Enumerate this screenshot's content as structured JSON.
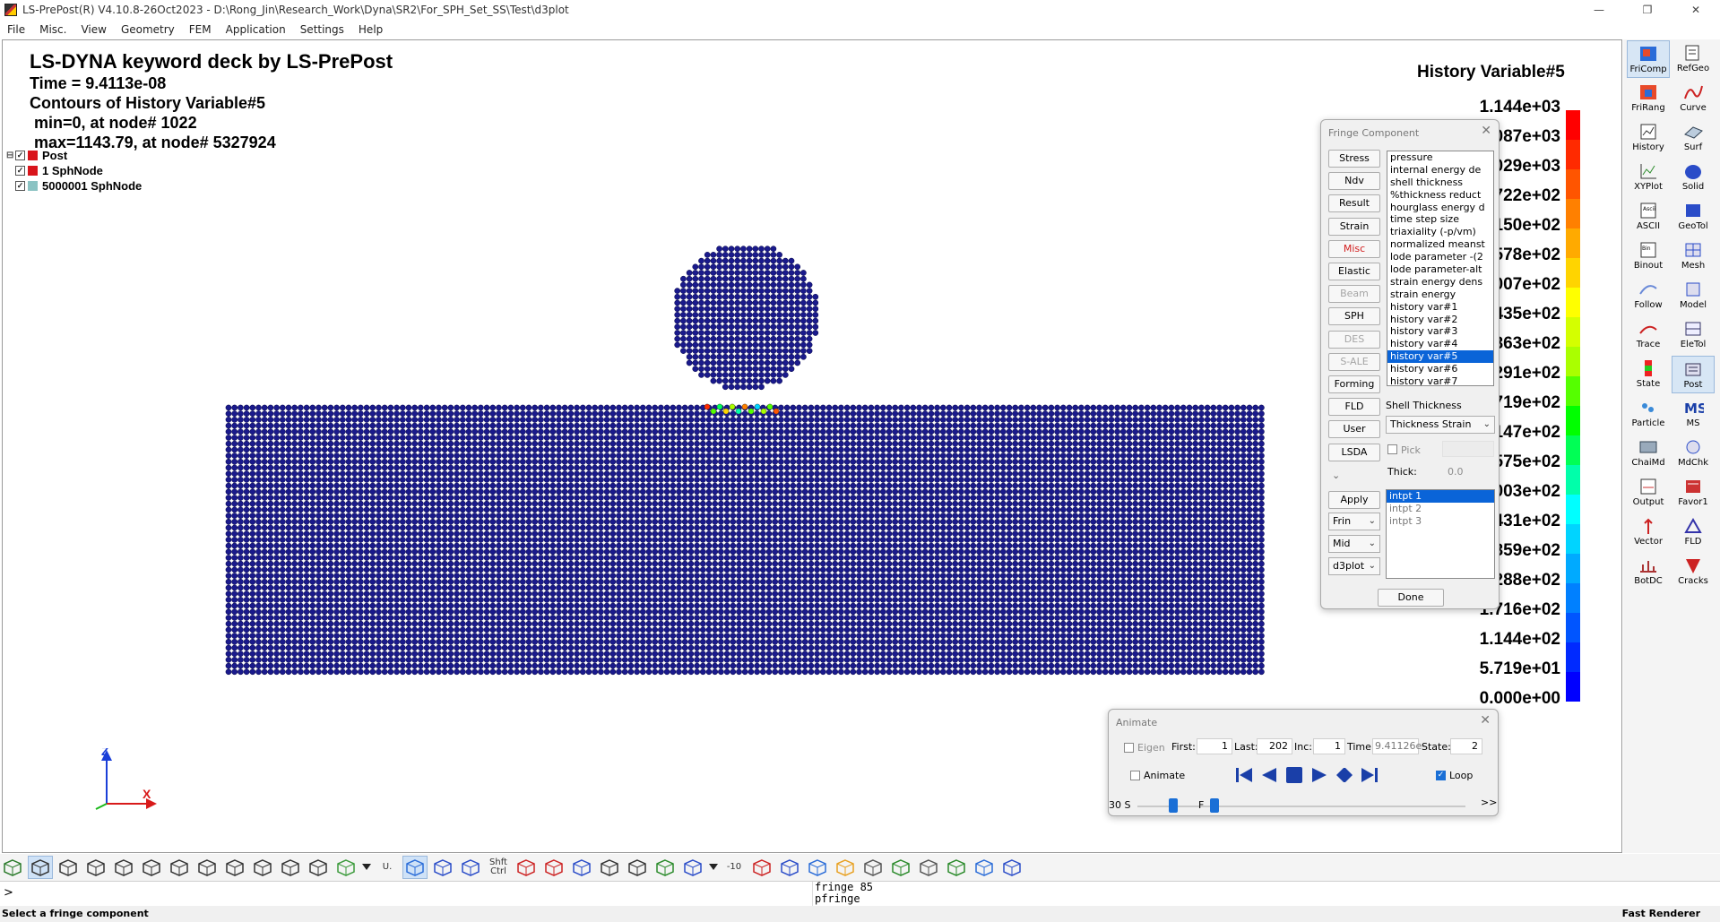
{
  "window": {
    "title": "LS-PrePost(R) V4.10.8-26Oct2023 - D:\\Rong_Jin\\Research_Work\\Dyna\\SR2\\For_SPH_Set_SS\\Test\\d3plot",
    "controls": [
      "—",
      "❐",
      "✕"
    ]
  },
  "menu": [
    "File",
    "Misc.",
    "View",
    "Geometry",
    "FEM",
    "Application",
    "Settings",
    "Help"
  ],
  "viewport": {
    "info_lines": [
      "LS-DYNA keyword deck by LS-PrePost",
      "Time =  9.4113e-08",
      "Contours of History Variable#5",
      " min=0, at node# 1022",
      " max=1143.79, at node# 5327924"
    ],
    "tree": {
      "root": "Post",
      "items": [
        {
          "label": "1 SphNode",
          "color": "#d9141b"
        },
        {
          "label": "5000001 SphNode",
          "color": "#8bc3c3"
        }
      ],
      "root_color": "#d9141b"
    },
    "particle_color": "#1a1a8c",
    "legend": {
      "title": "History Variable#5",
      "labels": [
        "1.144e+03",
        "1.087e+03",
        "1.029e+03",
        "9.722e+02",
        "9.150e+02",
        "8.578e+02",
        "8.007e+02",
        "7.435e+02",
        "6.863e+02",
        "6.291e+02",
        "5.719e+02",
        "5.147e+02",
        "4.575e+02",
        "4.003e+02",
        "3.431e+02",
        "2.859e+02",
        "2.288e+02",
        "1.716e+02",
        "1.144e+02",
        "5.719e+01",
        "0.000e+00"
      ],
      "colors": [
        "#ff0000",
        "#ff2a00",
        "#ff5500",
        "#ff8000",
        "#ffaa00",
        "#ffd400",
        "#ffff00",
        "#d4ff00",
        "#aaff00",
        "#55ff00",
        "#00ff00",
        "#00ff55",
        "#00ffaa",
        "#00ffff",
        "#00d4ff",
        "#00aaff",
        "#0080ff",
        "#0055ff",
        "#002aff",
        "#0000ff"
      ]
    },
    "axis": {
      "x": "X",
      "z": "Z"
    }
  },
  "palette": [
    {
      "label": "FriComp",
      "icon": "fringe-component-icon",
      "active": true
    },
    {
      "label": "RefGeo",
      "icon": "reference-geometry-icon"
    },
    {
      "label": "FriRang",
      "icon": "fringe-range-icon"
    },
    {
      "label": "Curve",
      "icon": "curve-icon"
    },
    {
      "label": "History",
      "icon": "history-icon"
    },
    {
      "label": "Surf",
      "icon": "surface-icon"
    },
    {
      "label": "XYPlot",
      "icon": "xy-plot-icon"
    },
    {
      "label": "Solid",
      "icon": "solid-icon"
    },
    {
      "label": "ASCII",
      "icon": "ascii-icon"
    },
    {
      "label": "GeoTol",
      "icon": "geometry-tools-icon"
    },
    {
      "label": "Binout",
      "icon": "binout-icon"
    },
    {
      "label": "Mesh",
      "icon": "mesh-icon"
    },
    {
      "label": "Follow",
      "icon": "follow-icon"
    },
    {
      "label": "Model",
      "icon": "model-icon"
    },
    {
      "label": "Trace",
      "icon": "trace-icon"
    },
    {
      "label": "EleTol",
      "icon": "element-tools-icon"
    },
    {
      "label": "State",
      "icon": "state-icon"
    },
    {
      "label": "Post",
      "icon": "post-icon",
      "active": true
    },
    {
      "label": "Particle",
      "icon": "particle-icon"
    },
    {
      "label": "MS",
      "icon": "ms-icon"
    },
    {
      "label": "ChaiMd",
      "icon": "chain-model-icon"
    },
    {
      "label": "MdChk",
      "icon": "model-check-icon"
    },
    {
      "label": "Output",
      "icon": "output-icon"
    },
    {
      "label": "Favor1",
      "icon": "favorite-icon"
    },
    {
      "label": "Vector",
      "icon": "vector-icon"
    },
    {
      "label": "FLD",
      "icon": "fld-icon"
    },
    {
      "label": "BotDC",
      "icon": "bolt-dc-icon"
    },
    {
      "label": "Cracks",
      "icon": "cracks-icon"
    }
  ],
  "fringe_dialog": {
    "title": "Fringe Component",
    "buttons": [
      {
        "label": "Stress",
        "state": "normal"
      },
      {
        "label": "Ndv",
        "state": "normal"
      },
      {
        "label": "Result",
        "state": "normal"
      },
      {
        "label": "Strain",
        "state": "normal"
      },
      {
        "label": "Misc",
        "state": "red"
      },
      {
        "label": "Elastic",
        "state": "normal"
      },
      {
        "label": "Beam",
        "state": "disabled"
      },
      {
        "label": "SPH",
        "state": "normal"
      },
      {
        "label": "DES",
        "state": "disabled"
      },
      {
        "label": "S-ALE",
        "state": "disabled"
      },
      {
        "label": "Forming",
        "state": "normal"
      },
      {
        "label": "FLD",
        "state": "normal"
      },
      {
        "label": "User",
        "state": "normal"
      },
      {
        "label": "LSDA",
        "state": "normal"
      }
    ],
    "components": [
      "pressure",
      "internal energy de",
      "shell thickness",
      "%thickness reduct",
      "hourglass energy d",
      "time step size",
      "triaxiality (-p/vm)",
      "normalized meanst",
      "lode parameter -(2",
      "lode parameter-alt",
      "strain energy dens",
      "strain energy",
      "history var#1",
      "history var#2",
      "history var#3",
      "history var#4",
      "history var#5",
      "history var#6",
      "history var#7"
    ],
    "selected_index": 16,
    "shell_thickness_label": "Shell Thickness",
    "thickness_combo": "Thickness Strain",
    "pick_label": "Pick",
    "thick_label": "Thick:",
    "thick_value": "0.0",
    "apply_label": "Apply",
    "combos": [
      "Frin",
      "Mid",
      "d3plot"
    ],
    "intpts": [
      "intpt   1",
      "intpt   2",
      "intpt   3"
    ],
    "done_label": "Done"
  },
  "animate_dialog": {
    "title": "Animate",
    "eigen_label": "Eigen",
    "first_label": "First:",
    "first_value": "1",
    "last_label": "Last:",
    "last_value": "202",
    "inc_label": "Inc:",
    "inc_value": "1",
    "time_label": "Time:",
    "time_value": "9.41126e-",
    "state_label": "State:",
    "state_value": "2",
    "animate_label": "Animate",
    "loop_label": "Loop",
    "speed_label": "30 S",
    "f_label": "F",
    "more_label": ">>",
    "speed_fraction": 0.44,
    "frame_fraction": 0.0
  },
  "toolbar": {
    "text_items": [
      "U.",
      "Shft\nCtrl",
      "-10"
    ]
  },
  "command": {
    "prompt": ">",
    "history": [
      "fringe 85",
      "pfringe"
    ]
  },
  "status": {
    "left": "Select a fringe component",
    "right": "Fast Renderer"
  }
}
